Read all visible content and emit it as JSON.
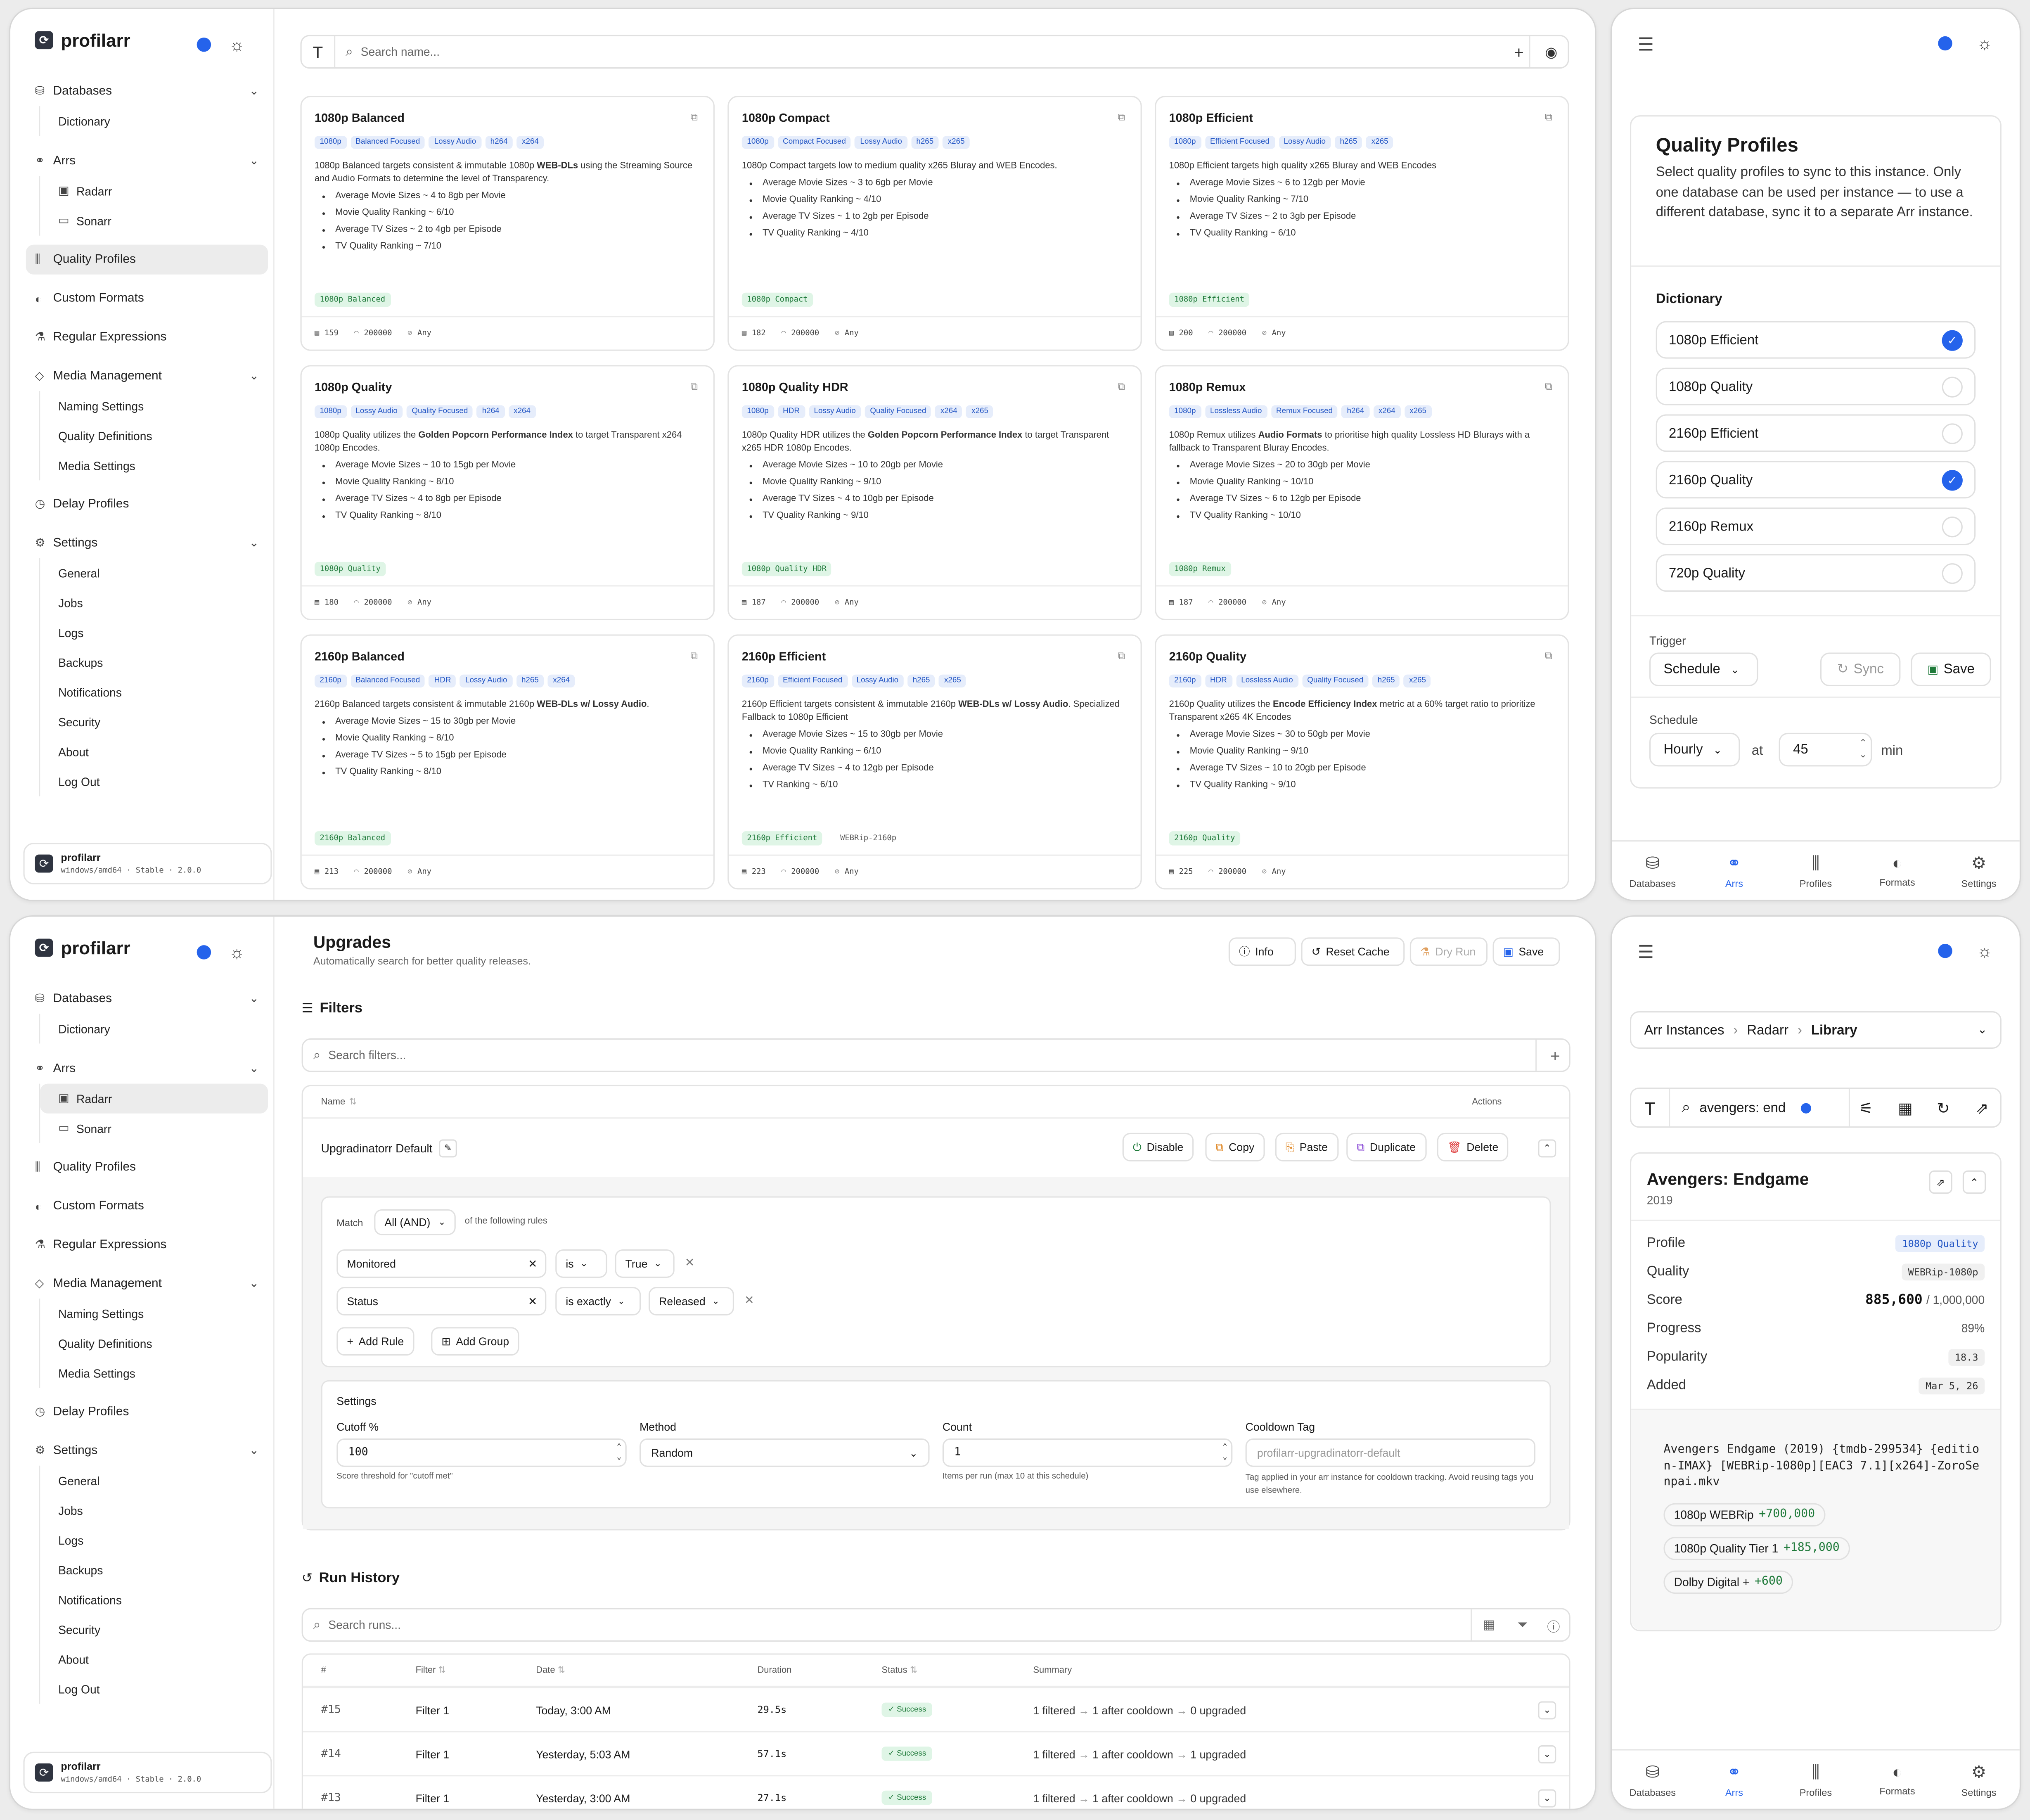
{
  "sidebar": {
    "app_name": "profilarr",
    "footer_name": "profilarr",
    "footer_version": "windows/amd64 · Stable · 2.0.0",
    "items": {
      "databases": "Databases",
      "dictionary": "Dictionary",
      "arrs": "Arrs",
      "radarr": "Radarr",
      "sonarr": "Sonarr",
      "quality_profiles": "Quality Profiles",
      "custom_formats": "Custom Formats",
      "regex": "Regular Expressions",
      "media_management": "Media Management",
      "naming": "Naming Settings",
      "quality_defs": "Quality Definitions",
      "media_settings": "Media Settings",
      "delay_profiles": "Delay Profiles",
      "settings": "Settings",
      "general": "General",
      "jobs": "Jobs",
      "logs": "Logs",
      "backups": "Backups",
      "notifications": "Notifications",
      "security": "Security",
      "about": "About",
      "logout": "Log Out"
    }
  },
  "profiles_page": {
    "search_placeholder": "Search name...",
    "cards": [
      {
        "title": "1080p Balanced",
        "tags": [
          "1080p",
          "Balanced Focused",
          "Lossy Audio",
          "h264",
          "x264"
        ],
        "desc_a": "1080p Balanced targets consistent & immutable 1080p ",
        "desc_b": "WEB-DLs",
        "desc_c": " using the Streaming Source and Audio Formats to determine the level of Transparency.",
        "bullets": [
          "Average Movie Sizes ~ 4 to 8gb per Movie",
          "Movie Quality Ranking ~ 6/10",
          "Average TV Sizes ~ 2 to 4gb per Episode",
          "TV Quality Ranking ~ 7/10"
        ],
        "badge": "1080p Balanced",
        "extra": "",
        "cf": "159",
        "score": "200000",
        "lang": "Any"
      },
      {
        "title": "1080p Compact",
        "tags": [
          "1080p",
          "Compact Focused",
          "Lossy Audio",
          "h265",
          "x265"
        ],
        "desc_a": "1080p Compact targets low to medium quality x265 Bluray and WEB Encodes.",
        "desc_b": "",
        "desc_c": "",
        "bullets": [
          "Average Movie Sizes ~ 3 to 6gb per Movie",
          "Movie Quality Ranking ~ 4/10",
          "Average TV Sizes ~ 1 to 2gb per Episode",
          "TV Quality Ranking ~ 4/10"
        ],
        "badge": "1080p Compact",
        "extra": "",
        "cf": "182",
        "score": "200000",
        "lang": "Any"
      },
      {
        "title": "1080p Efficient",
        "tags": [
          "1080p",
          "Efficient Focused",
          "Lossy Audio",
          "h265",
          "x265"
        ],
        "desc_a": "1080p Efficient targets high quality x265 Bluray and WEB Encodes",
        "desc_b": "",
        "desc_c": "",
        "bullets": [
          "Average Movie Sizes ~ 6 to 12gb per Movie",
          "Movie Quality Ranking ~ 7/10",
          "Average TV Sizes ~ 2 to 3gb per Episode",
          "TV Quality Ranking ~ 6/10"
        ],
        "badge": "1080p Efficient",
        "extra": "",
        "cf": "200",
        "score": "200000",
        "lang": "Any"
      },
      {
        "title": "1080p Quality",
        "tags": [
          "1080p",
          "Lossy Audio",
          "Quality Focused",
          "h264",
          "x264"
        ],
        "desc_a": "1080p Quality utilizes the ",
        "desc_b": "Golden Popcorn Performance Index",
        "desc_c": " to target Transparent x264 1080p Encodes.",
        "bullets": [
          "Average Movie Sizes ~ 10 to 15gb per Movie",
          "Movie Quality Ranking ~ 8/10",
          "Average TV Sizes ~ 4 to 8gb per Episode",
          "TV Quality Ranking ~ 8/10"
        ],
        "badge": "1080p Quality",
        "extra": "",
        "cf": "180",
        "score": "200000",
        "lang": "Any"
      },
      {
        "title": "1080p Quality HDR",
        "tags": [
          "1080p",
          "HDR",
          "Lossy Audio",
          "Quality Focused",
          "x264",
          "x265"
        ],
        "desc_a": "1080p Quality HDR utilizes the ",
        "desc_b": "Golden Popcorn Performance Index",
        "desc_c": " to target Transparent x265 HDR 1080p Encodes.",
        "bullets": [
          "Average Movie Sizes ~ 10 to 20gb per Movie",
          "Movie Quality Ranking ~ 9/10",
          "Average TV Sizes ~ 4 to 10gb per Episode",
          "TV Quality Ranking ~ 9/10"
        ],
        "badge": "1080p Quality HDR",
        "extra": "",
        "cf": "187",
        "score": "200000",
        "lang": "Any"
      },
      {
        "title": "1080p Remux",
        "tags": [
          "1080p",
          "Lossless Audio",
          "Remux Focused",
          "h264",
          "x264",
          "x265"
        ],
        "desc_a": "1080p Remux utilizes ",
        "desc_b": "Audio Formats",
        "desc_c": " to prioritise high quality Lossless HD Blurays with a fallback to Transparent Bluray Encodes.",
        "bullets": [
          "Average Movie Sizes ~ 20 to 30gb per Movie",
          "Movie Quality Ranking ~ 10/10",
          "Average TV Sizes ~ 6 to 12gb per Episode",
          "TV Quality Ranking ~ 10/10"
        ],
        "badge": "1080p Remux",
        "extra": "",
        "cf": "187",
        "score": "200000",
        "lang": "Any"
      },
      {
        "title": "2160p Balanced",
        "tags": [
          "2160p",
          "Balanced Focused",
          "HDR",
          "Lossy Audio",
          "h265",
          "x264"
        ],
        "desc_a": "2160p Balanced targets consistent & immutable 2160p ",
        "desc_b": "WEB-DLs w/ Lossy Audio",
        "desc_c": ".",
        "bullets": [
          "Average Movie Sizes ~ 15 to 30gb per Movie",
          "Movie Quality Ranking ~ 8/10",
          "Average TV Sizes ~ 5 to 15gb per Episode",
          "TV Quality Ranking ~ 8/10"
        ],
        "badge": "2160p Balanced",
        "extra": "",
        "cf": "213",
        "score": "200000",
        "lang": "Any"
      },
      {
        "title": "2160p Efficient",
        "tags": [
          "2160p",
          "Efficient Focused",
          "Lossy Audio",
          "h265",
          "x265"
        ],
        "desc_a": "2160p Efficient targets consistent & immutable 2160p ",
        "desc_b": "WEB-DLs w/ Lossy Audio",
        "desc_c": ". Specialized Fallback to 1080p Efficient",
        "bullets": [
          "Average Movie Sizes ~ 15 to 30gb per Movie",
          "Movie Quality Ranking ~ 6/10",
          "Average TV Sizes ~ 4 to 12gb per Episode",
          "TV Ranking ~ 6/10"
        ],
        "badge": "2160p Efficient",
        "extra": "WEBRip-2160p",
        "cf": "223",
        "score": "200000",
        "lang": "Any"
      },
      {
        "title": "2160p Quality",
        "tags": [
          "2160p",
          "HDR",
          "Lossless Audio",
          "Quality Focused",
          "h265",
          "x265"
        ],
        "desc_a": "2160p Quality utilizes the ",
        "desc_b": "Encode Efficiency Index",
        "desc_c": " metric at a 60% target ratio to prioritize Transparent x265 4K Encodes",
        "bullets": [
          "Average Movie Sizes ~ 30 to 50gb per Movie",
          "Movie Quality Ranking ~ 9/10",
          "Average TV Sizes ~ 10 to 20gb per Episode",
          "TV Quality Ranking ~ 9/10"
        ],
        "badge": "2160p Quality",
        "extra": "",
        "cf": "225",
        "score": "200000",
        "lang": "Any"
      }
    ]
  },
  "sync_panel": {
    "title": "Quality Profiles",
    "description": "Select quality profiles to sync to this instance. Only one database can be used per instance — to use a different database, sync it to a separate Arr instance.",
    "db_name": "Dictionary",
    "options": [
      {
        "label": "1080p Efficient",
        "checked": true
      },
      {
        "label": "1080p Quality",
        "checked": false
      },
      {
        "label": "2160p Efficient",
        "checked": false
      },
      {
        "label": "2160p Quality",
        "checked": true
      },
      {
        "label": "2160p Remux",
        "checked": false
      },
      {
        "label": "720p Quality",
        "checked": false
      }
    ],
    "trigger_label": "Trigger",
    "trigger_value": "Schedule",
    "sync_label": "Sync",
    "save_label": "Save",
    "schedule_label": "Schedule",
    "schedule_value": "Hourly",
    "at_label": "at",
    "minute_value": "45",
    "min_label": "min"
  },
  "tabbar": {
    "databases": "Databases",
    "arrs": "Arrs",
    "profiles": "Profiles",
    "formats": "Formats",
    "settings": "Settings"
  },
  "upgrades": {
    "title": "Upgrades",
    "subtitle": "Automatically search for better quality releases.",
    "info": "Info",
    "reset_cache": "Reset Cache",
    "dry_run": "Dry Run",
    "save": "Save",
    "filters_title": "Filters",
    "filter_search_placeholder": "Search filters...",
    "col_name": "Name",
    "col_actions": "Actions",
    "filter_name": "Upgradinatorr Default",
    "actions": {
      "disable": "Disable",
      "copy": "Copy",
      "paste": "Paste",
      "duplicate": "Duplicate",
      "delete": "Delete"
    },
    "match_label": "Match",
    "match_value": "All (AND)",
    "match_suffix": "of the following rules",
    "rules": [
      {
        "field": "Monitored",
        "op": "is",
        "value": "True"
      },
      {
        "field": "Status",
        "op": "is exactly",
        "value": "Released"
      }
    ],
    "add_rule": "Add Rule",
    "add_group": "Add Group",
    "settings_title": "Settings",
    "cutoff_label": "Cutoff %",
    "cutoff_value": "100",
    "cutoff_help": "Score threshold for \"cutoff met\"",
    "method_label": "Method",
    "method_value": "Random",
    "count_label": "Count",
    "count_value": "1",
    "count_help": "Items per run (max 10 at this schedule)",
    "cooldown_label": "Cooldown Tag",
    "cooldown_placeholder": "profilarr-upgradinatorr-default",
    "cooldown_help": "Tag applied in your arr instance for cooldown tracking. Avoid reusing tags you use elsewhere.",
    "history_title": "Run History",
    "history_search_placeholder": "Search runs...",
    "hist_cols": {
      "num": "#",
      "filter": "Filter",
      "date": "Date",
      "duration": "Duration",
      "status": "Status",
      "summary": "Summary"
    },
    "runs": [
      {
        "num": "#15",
        "filter": "Filter 1",
        "date": "Today, 3:00 AM",
        "duration": "29.5s",
        "status": "Success",
        "s1": "1 filtered",
        "s2": "1 after cooldown",
        "s3": "0 upgraded"
      },
      {
        "num": "#14",
        "filter": "Filter 1",
        "date": "Yesterday, 5:03 AM",
        "duration": "57.1s",
        "status": "Success",
        "s1": "1 filtered",
        "s2": "1 after cooldown",
        "s3": "1 upgraded"
      },
      {
        "num": "#13",
        "filter": "Filter 1",
        "date": "Yesterday, 3:00 AM",
        "duration": "27.1s",
        "status": "Success",
        "s1": "1 filtered",
        "s2": "1 after cooldown",
        "s3": "0 upgraded"
      }
    ]
  },
  "library": {
    "bc1": "Arr Instances",
    "bc2": "Radarr",
    "bc3": "Library",
    "search_value": "avengers: end",
    "movie_title": "Avengers: Endgame",
    "movie_year": "2019",
    "profile_label": "Profile",
    "profile_value": "1080p Quality",
    "quality_label": "Quality",
    "quality_value": "WEBRip-1080p",
    "score_label": "Score",
    "score_value": "885,600",
    "score_max": "/ 1,000,000",
    "progress_label": "Progress",
    "progress_value": "89%",
    "popularity_label": "Popularity",
    "popularity_value": "18.3",
    "added_label": "Added",
    "added_value": "Mar 5, 26",
    "filename": "Avengers Endgame (2019) {tmdb-299534} {edition-IMAX} [WEBRip-1080p][EAC3 7.1][x264]-ZoroSenpai.mkv",
    "formats": [
      {
        "name": "1080p WEBRip",
        "score": "+700,000"
      },
      {
        "name": "1080p Quality Tier 1",
        "score": "+185,000"
      },
      {
        "name": "Dolby Digital +",
        "score": "+600"
      }
    ]
  },
  "colors": {
    "accent": "#2563eb",
    "success": "#1f7a3a",
    "tag_blue": "#2255c4"
  }
}
